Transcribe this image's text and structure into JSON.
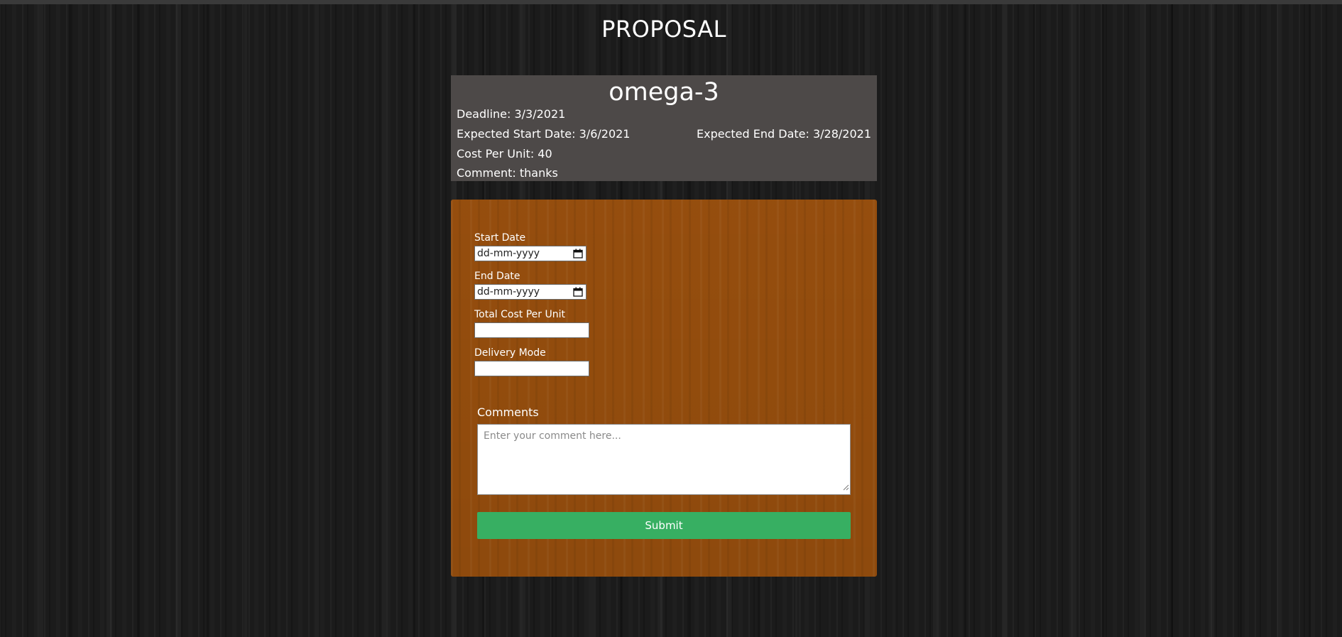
{
  "page": {
    "title": "PROPOSAL"
  },
  "summary": {
    "product_name": "omega-3",
    "deadline": "Deadline: 3/3/2021",
    "expected_start": "Expected Start Date: 3/6/2021",
    "expected_end": "Expected End Date: 3/28/2021",
    "cost_per_unit": "Cost Per Unit: 40",
    "comment": "Comment: thanks"
  },
  "form": {
    "start_date": {
      "label": "Start Date",
      "placeholder": "dd-mm-yyyy"
    },
    "end_date": {
      "label": "End Date",
      "placeholder": "dd-mm-yyyy"
    },
    "total_cost": {
      "label": "Total Cost Per Unit",
      "value": ""
    },
    "delivery_mode": {
      "label": "Delivery Mode",
      "value": ""
    },
    "comments": {
      "label": "Comments",
      "placeholder": "Enter your comment here..."
    },
    "submit_label": "Submit"
  },
  "icons": {
    "date": "calendar-icon",
    "resize": "resize-grip-icon"
  },
  "colors": {
    "summary_bg": "#4d4948",
    "form_bg": "#9a500e",
    "submit_bg": "#37af62",
    "page_bg": "#1b1b1b"
  }
}
